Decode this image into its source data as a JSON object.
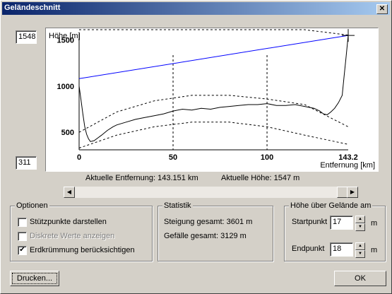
{
  "window": {
    "title": "Geländeschnitt",
    "close_glyph": "✕"
  },
  "plot": {
    "max_height_value": "1548",
    "min_height_value": "311",
    "current_distance": "Aktuelle Entfernung: 143.151 km",
    "current_height": "Aktuelle Höhe: 1547 m"
  },
  "chart_data": {
    "type": "line",
    "ylabel": "Höhe [m]",
    "xlabel": "Entfernung [km]",
    "xlim": [
      0,
      143.2
    ],
    "ylim": [
      311,
      1548
    ],
    "x_ticks": [
      "0",
      "50",
      "100",
      "143.2"
    ],
    "y_ticks": [
      "500",
      "1000",
      "1500"
    ],
    "vertical_markers_km": [
      50,
      100
    ],
    "series": [
      {
        "role": "terrain",
        "color": "#000000",
        "x": [
          0,
          1,
          2,
          3,
          4,
          5,
          6,
          8,
          10,
          12,
          15,
          18,
          20,
          25,
          30,
          35,
          40,
          45,
          50,
          55,
          60,
          65,
          70,
          75,
          80,
          85,
          90,
          95,
          100,
          105,
          110,
          115,
          120,
          125,
          128,
          130,
          132,
          134,
          136,
          138,
          140,
          141,
          142,
          143.2
        ],
        "y": [
          1000,
          850,
          700,
          560,
          480,
          430,
          400,
          410,
          440,
          470,
          520,
          560,
          580,
          610,
          640,
          660,
          680,
          700,
          730,
          750,
          740,
          760,
          750,
          770,
          780,
          790,
          800,
          800,
          810,
          790,
          790,
          800,
          780,
          760,
          730,
          700,
          690,
          720,
          760,
          820,
          900,
          1100,
          1300,
          1547
        ]
      },
      {
        "role": "line-of-sight",
        "color": "#0000ff",
        "x": [
          0,
          143.2
        ],
        "y": [
          1080,
          1547
        ]
      },
      {
        "role": "earth-curvature-upper",
        "color": "#000000",
        "dash": true,
        "x": [
          0,
          20,
          40,
          60,
          80,
          100,
          120,
          143.2
        ],
        "y": [
          1620,
          1720,
          1780,
          1800,
          1780,
          1730,
          1660,
          1550
        ]
      },
      {
        "role": "earth-curvature-mid",
        "color": "#000000",
        "dash": true,
        "x": [
          0,
          20,
          40,
          60,
          80,
          100,
          120,
          143.2
        ],
        "y": [
          500,
          720,
          840,
          900,
          900,
          860,
          800,
          560
        ]
      },
      {
        "role": "earth-curvature-lower",
        "color": "#000000",
        "dash": true,
        "x": [
          0,
          20,
          40,
          60,
          80,
          100,
          120,
          143.2
        ],
        "y": [
          330,
          470,
          560,
          610,
          610,
          560,
          470,
          370
        ]
      }
    ]
  },
  "options": {
    "title": "Optionen",
    "items": [
      {
        "label": "Stützpunkte darstellen",
        "checked": false,
        "enabled": true
      },
      {
        "label": "Diskrete Werte anzeigen",
        "checked": false,
        "enabled": false
      },
      {
        "label": "Erdkrümmung berücksichtigen",
        "checked": true,
        "enabled": true
      }
    ]
  },
  "stats": {
    "title": "Statistik",
    "ascent": "Steigung gesamt: 3601 m",
    "descent": "Gefälle gesamt: 3129 m"
  },
  "height_above": {
    "title": "Höhe über Gelände am",
    "start_label": "Startpunkt",
    "start_value": "17",
    "end_label": "Endpunkt",
    "end_value": "18",
    "unit": "m"
  },
  "buttons": {
    "print": "Drucken...",
    "ok": "OK"
  }
}
